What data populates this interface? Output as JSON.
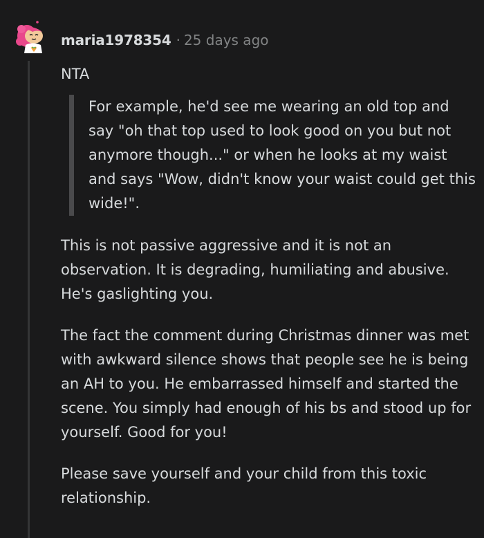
{
  "comment": {
    "author": "maria1978354",
    "separator": "·",
    "time": "25 days ago",
    "paragraphs": {
      "nta": "NTA",
      "quote": "For example, he'd see me wearing an old top and say \"oh that top used to look good on you but not anymore though...\" or when he looks at my waist and says \"Wow, didn't know your waist could get this wide!\".",
      "p1": "This is not passive aggressive and it is not an observation. It is degrading, humiliating and abusive. He's gaslighting you.",
      "p2": "The fact the comment during Christmas dinner was met with awkward silence shows that people see he is being an AH to you. He embarrassed himself and started the scene. You simply had enough of his bs and stood up for yourself. Good for you!",
      "p3": "Please save yourself and your child from this toxic relationship."
    }
  },
  "colors": {
    "background": "#1a1a1b",
    "text": "#d7dadc",
    "meta": "#818384",
    "quote_bar": "#4a4a4c",
    "thread_line": "#343536",
    "avatar_hair": "#e8478b",
    "avatar_skin": "#f2c99a"
  },
  "icons": {
    "avatar": "snoo-avatar-icon"
  }
}
